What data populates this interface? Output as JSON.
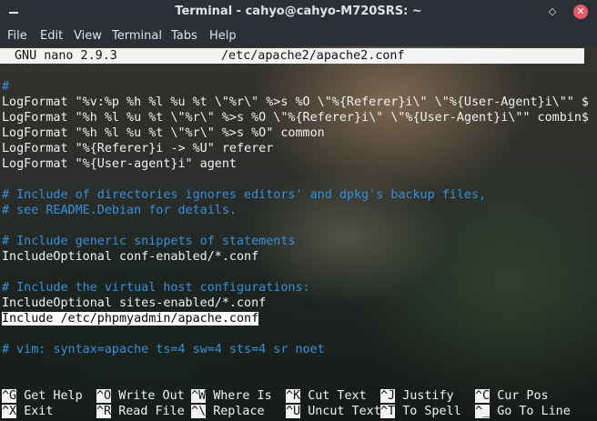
{
  "window": {
    "title": "Terminal - cahyo@cahyo-M720SRS: ~",
    "minimize_glyph": "",
    "maximize_glyph": "◇",
    "close_glyph": "✕"
  },
  "menu": [
    "File",
    "Edit",
    "View",
    "Terminal",
    "Tabs",
    "Help"
  ],
  "nano": {
    "version": "GNU nano 2.9.3",
    "filename": "/etc/apache2/apache2.conf"
  },
  "lines": [
    "#",
    "LogFormat \"%v:%p %h %l %u %t \\\"%r\\\" %>s %O \\\"%{Referer}i\\\" \\\"%{User-Agent}i\\\"\" $",
    "LogFormat \"%h %l %u %t \\\"%r\\\" %>s %O \\\"%{Referer}i\\\" \\\"%{User-Agent}i\\\"\" combin$",
    "LogFormat \"%h %l %u %t \\\"%r\\\" %>s %O\" common",
    "LogFormat \"%{Referer}i -> %U\" referer",
    "LogFormat \"%{User-agent}i\" agent",
    "",
    "# Include of directories ignores editors' and dpkg's backup files,",
    "# see README.Debian for details.",
    "",
    "# Include generic snippets of statements",
    "IncludeOptional conf-enabled/*.conf",
    "",
    "# Include the virtual host configurations:",
    "IncludeOptional sites-enabled/*.conf",
    "Include /etc/phpmyadmin/apache.con",
    "f",
    "",
    "# vim: syntax=apache ts=4 sw=4 sts=4 sr noet"
  ],
  "shortcuts": {
    "row1": [
      {
        "key": "^G",
        "label": "Get Help"
      },
      {
        "key": "^O",
        "label": "Write Out"
      },
      {
        "key": "^W",
        "label": "Where Is"
      },
      {
        "key": "^K",
        "label": "Cut Text"
      },
      {
        "key": "^J",
        "label": "Justify"
      },
      {
        "key": "^C",
        "label": "Cur Pos"
      }
    ],
    "row2": [
      {
        "key": "^X",
        "label": "Exit"
      },
      {
        "key": "^R",
        "label": "Read File"
      },
      {
        "key": "^\\",
        "label": "Replace"
      },
      {
        "key": "^U",
        "label": "Uncut Text"
      },
      {
        "key": "^T",
        "label": "To Spell"
      },
      {
        "key": "^_",
        "label": "Go To Line"
      }
    ]
  }
}
